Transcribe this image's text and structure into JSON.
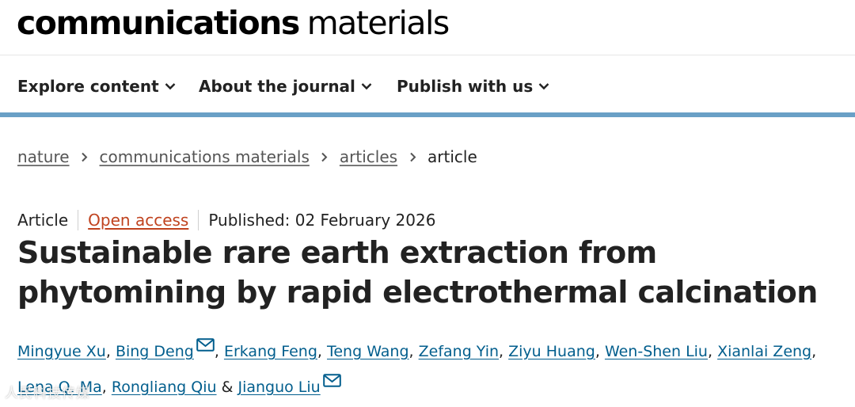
{
  "brand": {
    "name_bold": "communications",
    "name_light": "materials"
  },
  "nav": {
    "items": [
      {
        "label": "Explore content"
      },
      {
        "label": "About the journal"
      },
      {
        "label": "Publish with us"
      }
    ]
  },
  "breadcrumb": {
    "items": [
      "nature",
      "communications materials",
      "articles"
    ],
    "current": "article"
  },
  "article": {
    "type": "Article",
    "access": "Open access",
    "published": "Published: 02 February 2026",
    "title": "Sustainable rare earth extraction from phytomining by rapid electrothermal calcination",
    "authors": [
      "Mingyue Xu",
      "Bing Deng",
      "Erkang Feng",
      "Teng Wang",
      "Zefang Yin",
      "Ziyu Huang",
      "Wen-Shen Liu",
      "Xianlai Zeng",
      "Lena Q. Ma",
      "Rongliang Qiu",
      "Jianguo Liu"
    ],
    "and_symbol": "&",
    "comma": ","
  },
  "colors": {
    "accent_bar": "#6aa0c6",
    "link": "#025e8d",
    "open_access": "#c0431f"
  },
  "watermark": "人民科技传媒"
}
